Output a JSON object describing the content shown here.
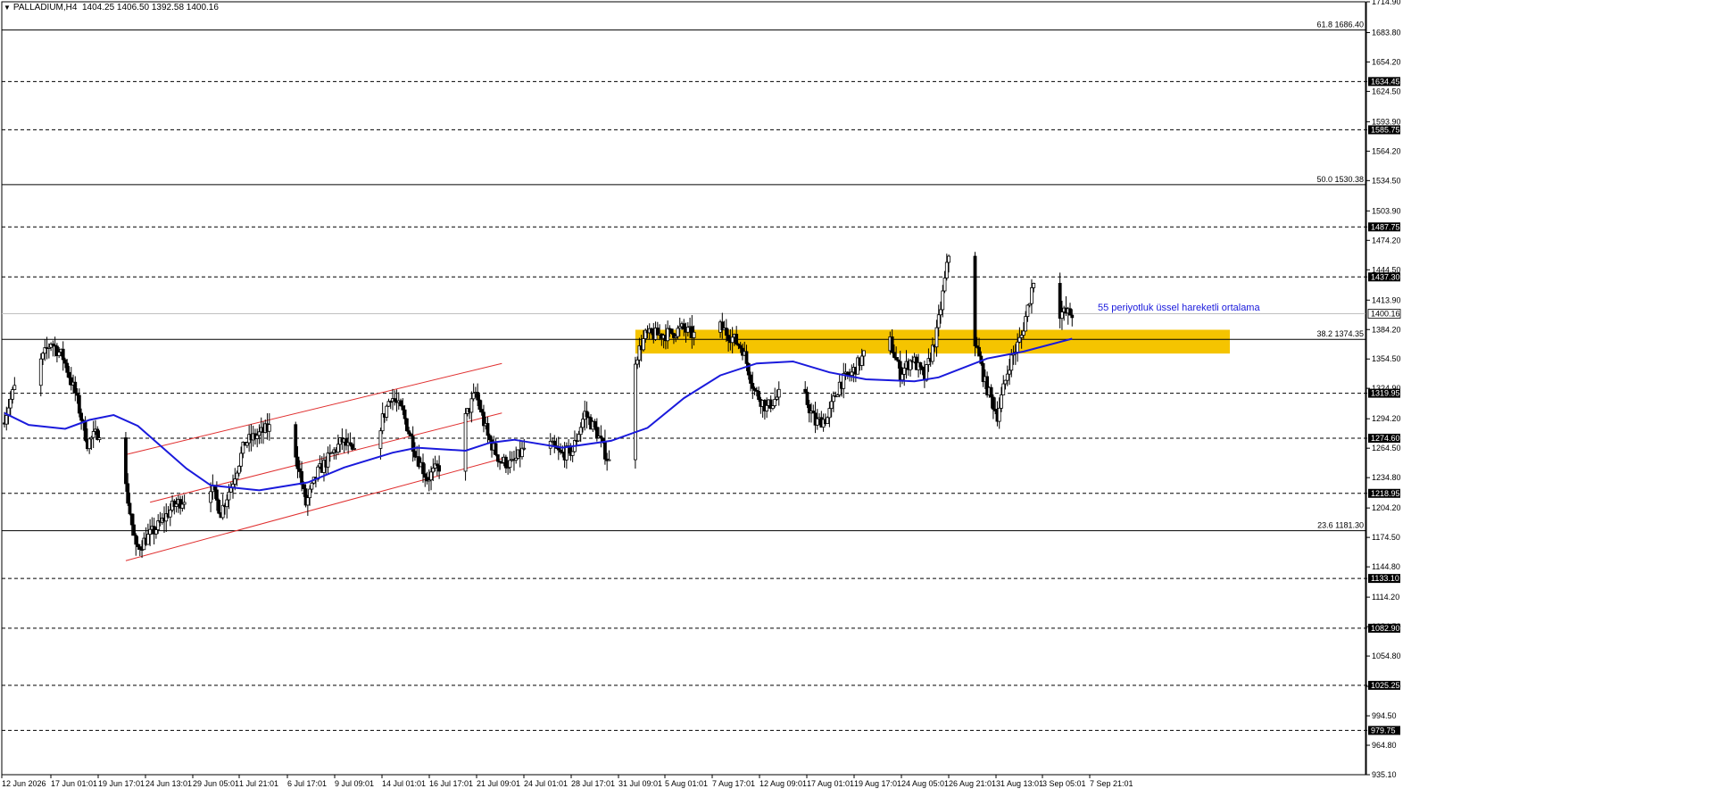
{
  "header": {
    "symbol": "PALLADIUM,H4",
    "ohlc": "1404.25 1406.50 1392.58 1400.16"
  },
  "annotation": {
    "ema_label": "55 periyotluk üssel hareketli ortalama"
  },
  "colors": {
    "candle": "#000000",
    "ema": "#1a1adc",
    "channel": "#e03030",
    "zone": "#f5c400",
    "grid": "#000000",
    "current_price_line": "#c0c0c0"
  },
  "chart_data": {
    "type": "candlestick",
    "symbol": "PALLADIUM",
    "timeframe": "H4",
    "ylim": [
      935.1,
      1714.9
    ],
    "y_ticks": [
      "1714.90",
      "1683.80",
      "1654.20",
      "1624.50",
      "1593.90",
      "1564.20",
      "1534.50",
      "1503.90",
      "1474.20",
      "1444.50",
      "1413.90",
      "1384.20",
      "1354.50",
      "1324.90",
      "1294.20",
      "1264.50",
      "1234.80",
      "1204.20",
      "1174.50",
      "1144.80",
      "1114.20",
      "1084.50",
      "1054.80",
      "1024.20",
      "994.50",
      "964.80",
      "935.10"
    ],
    "x_ticks": [
      "12 Jun 2026",
      "17 Jun 01:01",
      "19 Jun 17:01",
      "24 Jun 13:01",
      "29 Jun 05:01",
      "1 Jul 21:01",
      "6 Jul 17:01",
      "9 Jul 09:01",
      "14 Jul 01:01",
      "16 Jul 17:01",
      "21 Jul 09:01",
      "24 Jul 01:01",
      "28 Jul 17:01",
      "31 Jul 09:01",
      "5 Aug 01:01",
      "7 Aug 17:01",
      "12 Aug 09:01",
      "17 Aug 01:01",
      "19 Aug 17:01",
      "24 Aug 05:01",
      "26 Aug 21:01",
      "31 Aug 13:01",
      "3 Sep 05:01",
      "7 Sep 21:01"
    ],
    "horizontal_levels": [
      {
        "value": 1634.45,
        "label": "1634.45",
        "style": "dashed"
      },
      {
        "value": 1585.75,
        "label": "1585.75",
        "style": "dashed"
      },
      {
        "value": 1487.75,
        "label": "1487.75",
        "style": "dashed"
      },
      {
        "value": 1437.3,
        "label": "1437.30",
        "style": "dashed"
      },
      {
        "value": 1319.95,
        "label": "1319.95",
        "style": "dashed"
      },
      {
        "value": 1274.6,
        "label": "1274.60",
        "style": "dashed"
      },
      {
        "value": 1218.95,
        "label": "1218.95",
        "style": "dashed"
      },
      {
        "value": 1133.1,
        "label": "1133.10",
        "style": "dashed"
      },
      {
        "value": 1082.9,
        "label": "1082.90",
        "style": "dashed"
      },
      {
        "value": 1025.25,
        "label": "1025.25",
        "style": "dashed"
      },
      {
        "value": 979.75,
        "label": "979.75",
        "style": "dashed"
      }
    ],
    "fibonacci": [
      {
        "label": "61.8 1686.40",
        "value": 1686.4
      },
      {
        "label": "50.0 1530.38",
        "value": 1530.38
      },
      {
        "label": "38.2 1374.35",
        "value": 1374.35
      },
      {
        "label": "23.6 1181.30",
        "value": 1181.3
      }
    ],
    "current_price": {
      "value": 1400.16,
      "label": "1400.16"
    },
    "resistance_zone": {
      "from": 1360,
      "to": 1384,
      "x_start": "3 Aug 2026",
      "x_end": "21 Sep 2026"
    },
    "channel": {
      "upper": [
        {
          "x": "22 Jun 2026",
          "y": 1258
        },
        {
          "x": "23 Jul 2026",
          "y": 1350
        }
      ],
      "middle": [
        {
          "x": "24 Jun 2026",
          "y": 1210
        },
        {
          "x": "23 Jul 2026",
          "y": 1300
        }
      ],
      "lower": [
        {
          "x": "22 Jun 2026",
          "y": 1151
        },
        {
          "x": "23 Jul 2026",
          "y": 1254
        }
      ]
    },
    "ema_period": 55,
    "ema": [
      {
        "x": "12 Jun 2026",
        "y": 1300
      },
      {
        "x": "14 Jun 2026",
        "y": 1288
      },
      {
        "x": "17 Jun 2026",
        "y": 1284
      },
      {
        "x": "19 Jun 2026",
        "y": 1293
      },
      {
        "x": "21 Jun 2026",
        "y": 1298
      },
      {
        "x": "23 Jun 2026",
        "y": 1287
      },
      {
        "x": "27 Jun 2026",
        "y": 1244
      },
      {
        "x": "29 Jun 2026",
        "y": 1227
      },
      {
        "x": "3 Jul 2026",
        "y": 1222
      },
      {
        "x": "7 Jul 2026",
        "y": 1230
      },
      {
        "x": "10 Jul 2026",
        "y": 1245
      },
      {
        "x": "14 Jul 2026",
        "y": 1260
      },
      {
        "x": "16 Jul 2026",
        "y": 1265
      },
      {
        "x": "20 Jul 2026",
        "y": 1262
      },
      {
        "x": "22 Jul 2026",
        "y": 1270
      },
      {
        "x": "24 Jul 2026",
        "y": 1273
      },
      {
        "x": "28 Jul 2026",
        "y": 1265
      },
      {
        "x": "1 Aug 2026",
        "y": 1272
      },
      {
        "x": "4 Aug 2026",
        "y": 1285
      },
      {
        "x": "7 Aug 2026",
        "y": 1315
      },
      {
        "x": "10 Aug 2026",
        "y": 1338
      },
      {
        "x": "13 Aug 2026",
        "y": 1350
      },
      {
        "x": "16 Aug 2026",
        "y": 1352
      },
      {
        "x": "19 Aug 2026",
        "y": 1341
      },
      {
        "x": "22 Aug 2026",
        "y": 1334
      },
      {
        "x": "26 Aug 2026",
        "y": 1332
      },
      {
        "x": "28 Aug 2026",
        "y": 1336
      },
      {
        "x": "1 Sep 2026",
        "y": 1355
      },
      {
        "x": "4 Sep 2026",
        "y": 1362
      },
      {
        "x": "8 Sep 2026",
        "y": 1375
      }
    ],
    "price_path": [
      {
        "x": "12 Jun 2026",
        "y": 1290
      },
      {
        "x": "13 Jun 2026",
        "y": 1325
      },
      {
        "x": "14 Jun 2026",
        "y": 1362
      },
      {
        "x": "15 Jun 2026",
        "y": 1348
      },
      {
        "x": "16 Jun 2026",
        "y": 1372
      },
      {
        "x": "17 Jun 2026",
        "y": 1356
      },
      {
        "x": "18 Jun 2026",
        "y": 1320
      },
      {
        "x": "19 Jun 2026",
        "y": 1270
      },
      {
        "x": "20 Jun 2026",
        "y": 1282
      },
      {
        "x": "21 Jun 2026",
        "y": 1262
      },
      {
        "x": "22 Jun 2026",
        "y": 1238
      },
      {
        "x": "23 Jun 2026",
        "y": 1162
      },
      {
        "x": "25 Jun 2026",
        "y": 1188
      },
      {
        "x": "26 Jun 2026",
        "y": 1205
      },
      {
        "x": "28 Jun 2026",
        "y": 1222
      },
      {
        "x": "29 Jun 2026",
        "y": 1232
      },
      {
        "x": "30 Jun 2026",
        "y": 1200
      },
      {
        "x": "1 Jul 2026",
        "y": 1232
      },
      {
        "x": "2 Jul 2026",
        "y": 1270
      },
      {
        "x": "4 Jul 2026",
        "y": 1285
      },
      {
        "x": "6 Jul 2026",
        "y": 1270
      },
      {
        "x": "7 Jul 2026",
        "y": 1208
      },
      {
        "x": "8 Jul 2026",
        "y": 1240
      },
      {
        "x": "10 Jul 2026",
        "y": 1272
      },
      {
        "x": "11 Jul 2026",
        "y": 1258
      },
      {
        "x": "13 Jul 2026",
        "y": 1282
      },
      {
        "x": "14 Jul 2026",
        "y": 1318
      },
      {
        "x": "15 Jul 2026",
        "y": 1300
      },
      {
        "x": "16 Jul 2026",
        "y": 1262
      },
      {
        "x": "17 Jul 2026",
        "y": 1234
      },
      {
        "x": "19 Jul 2026",
        "y": 1258
      },
      {
        "x": "20 Jul 2026",
        "y": 1290
      },
      {
        "x": "21 Jul 2026",
        "y": 1320
      },
      {
        "x": "22 Jul 2026",
        "y": 1276
      },
      {
        "x": "23 Jul 2026",
        "y": 1252
      },
      {
        "x": "24 Jul 2026",
        "y": 1248
      },
      {
        "x": "26 Jul 2026",
        "y": 1280
      },
      {
        "x": "28 Jul 2026",
        "y": 1258
      },
      {
        "x": "29 Jul 2026",
        "y": 1262
      },
      {
        "x": "30 Jul 2026",
        "y": 1300
      },
      {
        "x": "31 Jul 2026",
        "y": 1280
      },
      {
        "x": "1 Aug 2026",
        "y": 1250
      },
      {
        "x": "2 Aug 2026",
        "y": 1282
      },
      {
        "x": "3 Aug 2026",
        "y": 1350
      },
      {
        "x": "4 Aug 2026",
        "y": 1378
      },
      {
        "x": "6 Aug 2026",
        "y": 1380
      },
      {
        "x": "7 Aug 2026",
        "y": 1385
      },
      {
        "x": "9 Aug 2026",
        "y": 1372
      },
      {
        "x": "10 Aug 2026",
        "y": 1388
      },
      {
        "x": "11 Aug 2026",
        "y": 1378
      },
      {
        "x": "12 Aug 2026",
        "y": 1365
      },
      {
        "x": "13 Aug 2026",
        "y": 1322
      },
      {
        "x": "14 Aug 2026",
        "y": 1305
      },
      {
        "x": "15 Aug 2026",
        "y": 1318
      },
      {
        "x": "16 Aug 2026",
        "y": 1332
      },
      {
        "x": "17 Aug 2026",
        "y": 1320
      },
      {
        "x": "18 Aug 2026",
        "y": 1290
      },
      {
        "x": "19 Aug 2026",
        "y": 1295
      },
      {
        "x": "20 Aug 2026",
        "y": 1330
      },
      {
        "x": "21 Aug 2026",
        "y": 1340
      },
      {
        "x": "22 Aug 2026",
        "y": 1358
      },
      {
        "x": "23 Aug 2026",
        "y": 1370
      },
      {
        "x": "24 Aug 2026",
        "y": 1378
      },
      {
        "x": "25 Aug 2026",
        "y": 1340
      },
      {
        "x": "26 Aug 2026",
        "y": 1355
      },
      {
        "x": "27 Aug 2026",
        "y": 1335
      },
      {
        "x": "28 Aug 2026",
        "y": 1380
      },
      {
        "x": "29 Aug 2026",
        "y": 1460
      },
      {
        "x": "30 Aug 2026",
        "y": 1420
      },
      {
        "x": "31 Aug 2026",
        "y": 1380
      },
      {
        "x": "1 Sep 2026",
        "y": 1330
      },
      {
        "x": "2 Sep 2026",
        "y": 1298
      },
      {
        "x": "3 Sep 2026",
        "y": 1350
      },
      {
        "x": "4 Sep 2026",
        "y": 1378
      },
      {
        "x": "5 Sep 2026",
        "y": 1435
      },
      {
        "x": "6 Sep 2026",
        "y": 1412
      },
      {
        "x": "7 Sep 2026",
        "y": 1402
      },
      {
        "x": "8 Sep 2026",
        "y": 1400
      }
    ]
  }
}
